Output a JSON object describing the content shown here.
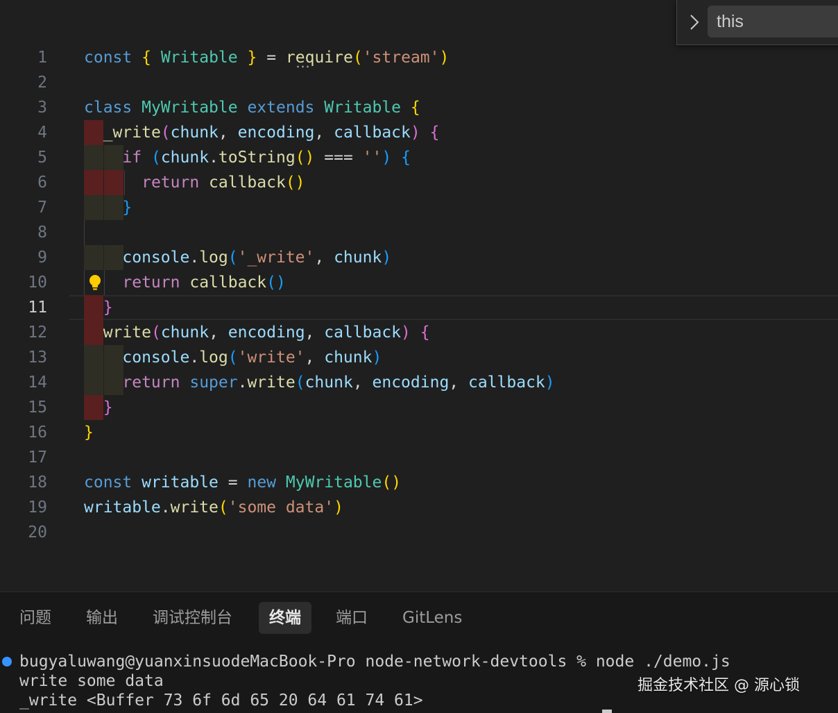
{
  "editor": {
    "line_numbers": [
      "1",
      "2",
      "3",
      "4",
      "5",
      "6",
      "7",
      "8",
      "9",
      "10",
      "11",
      "12",
      "13",
      "14",
      "15",
      "16",
      "17",
      "18",
      "19",
      "20"
    ],
    "current_line": "11",
    "lines": [
      [
        [
          "kw",
          "const"
        ],
        [
          "pl",
          " "
        ],
        [
          "b1",
          "{"
        ],
        [
          "pl",
          " "
        ],
        [
          "cls",
          "Writable"
        ],
        [
          "pl",
          " "
        ],
        [
          "b1",
          "}"
        ],
        [
          "pl",
          " "
        ],
        [
          "op",
          "="
        ],
        [
          "pl",
          " "
        ],
        [
          "fn",
          "require"
        ],
        [
          "b1",
          "("
        ],
        [
          "str",
          "'stream'"
        ],
        [
          "b1",
          ")"
        ]
      ],
      [],
      [
        [
          "kw",
          "class"
        ],
        [
          "pl",
          " "
        ],
        [
          "cls",
          "MyWritable"
        ],
        [
          "pl",
          " "
        ],
        [
          "kw",
          "extends"
        ],
        [
          "pl",
          " "
        ],
        [
          "cls",
          "Writable"
        ],
        [
          "pl",
          " "
        ],
        [
          "b1",
          "{"
        ]
      ],
      [
        [
          "pl",
          "  "
        ],
        [
          "fn",
          "_write"
        ],
        [
          "b2",
          "("
        ],
        [
          "par",
          "chunk"
        ],
        [
          "pl",
          ", "
        ],
        [
          "par",
          "encoding"
        ],
        [
          "pl",
          ", "
        ],
        [
          "par",
          "callback"
        ],
        [
          "b2",
          ")"
        ],
        [
          "pl",
          " "
        ],
        [
          "b2",
          "{"
        ]
      ],
      [
        [
          "pl",
          "    "
        ],
        [
          "ctl",
          "if"
        ],
        [
          "pl",
          " "
        ],
        [
          "b3",
          "("
        ],
        [
          "var",
          "chunk"
        ],
        [
          "pl",
          "."
        ],
        [
          "fn",
          "toString"
        ],
        [
          "b1",
          "()"
        ],
        [
          "pl",
          " "
        ],
        [
          "op",
          "==="
        ],
        [
          "pl",
          " "
        ],
        [
          "str",
          "''"
        ],
        [
          "b3",
          ")"
        ],
        [
          "pl",
          " "
        ],
        [
          "b3",
          "{"
        ]
      ],
      [
        [
          "pl",
          "      "
        ],
        [
          "ctl",
          "return"
        ],
        [
          "pl",
          " "
        ],
        [
          "fn",
          "callback"
        ],
        [
          "b1",
          "()"
        ]
      ],
      [
        [
          "pl",
          "    "
        ],
        [
          "b3",
          "}"
        ]
      ],
      [],
      [
        [
          "pl",
          "    "
        ],
        [
          "var",
          "console"
        ],
        [
          "pl",
          "."
        ],
        [
          "fn",
          "log"
        ],
        [
          "b3",
          "("
        ],
        [
          "str",
          "'_write'"
        ],
        [
          "pl",
          ", "
        ],
        [
          "var",
          "chunk"
        ],
        [
          "b3",
          ")"
        ]
      ],
      [
        [
          "pl",
          "    "
        ],
        [
          "ctl",
          "return"
        ],
        [
          "pl",
          " "
        ],
        [
          "fn",
          "callback"
        ],
        [
          "b3",
          "()"
        ]
      ],
      [
        [
          "pl",
          "  "
        ],
        [
          "b2",
          "}"
        ]
      ],
      [
        [
          "pl",
          "  "
        ],
        [
          "fn",
          "write"
        ],
        [
          "b2",
          "("
        ],
        [
          "par",
          "chunk"
        ],
        [
          "pl",
          ", "
        ],
        [
          "par",
          "encoding"
        ],
        [
          "pl",
          ", "
        ],
        [
          "par",
          "callback"
        ],
        [
          "b2",
          ")"
        ],
        [
          "pl",
          " "
        ],
        [
          "b2",
          "{"
        ]
      ],
      [
        [
          "pl",
          "    "
        ],
        [
          "var",
          "console"
        ],
        [
          "pl",
          "."
        ],
        [
          "fn",
          "log"
        ],
        [
          "b3",
          "("
        ],
        [
          "str",
          "'write'"
        ],
        [
          "pl",
          ", "
        ],
        [
          "var",
          "chunk"
        ],
        [
          "b3",
          ")"
        ]
      ],
      [
        [
          "pl",
          "    "
        ],
        [
          "ctl",
          "return"
        ],
        [
          "pl",
          " "
        ],
        [
          "kw",
          "super"
        ],
        [
          "pl",
          "."
        ],
        [
          "fn",
          "write"
        ],
        [
          "b3",
          "("
        ],
        [
          "var",
          "chunk"
        ],
        [
          "pl",
          ", "
        ],
        [
          "var",
          "encoding"
        ],
        [
          "pl",
          ", "
        ],
        [
          "var",
          "callback"
        ],
        [
          "b3",
          ")"
        ]
      ],
      [
        [
          "pl",
          "  "
        ],
        [
          "b2",
          "}"
        ]
      ],
      [
        [
          "b1",
          "}"
        ]
      ],
      [],
      [
        [
          "kw",
          "const"
        ],
        [
          "pl",
          " "
        ],
        [
          "var",
          "writable"
        ],
        [
          "pl",
          " "
        ],
        [
          "op",
          "="
        ],
        [
          "pl",
          " "
        ],
        [
          "kw",
          "new"
        ],
        [
          "pl",
          " "
        ],
        [
          "cls",
          "MyWritable"
        ],
        [
          "b1",
          "()"
        ]
      ],
      [
        [
          "var",
          "writable"
        ],
        [
          "pl",
          "."
        ],
        [
          "fn",
          "write"
        ],
        [
          "b1",
          "("
        ],
        [
          "str",
          "'some data'"
        ],
        [
          "b1",
          ")"
        ]
      ],
      []
    ]
  },
  "find": {
    "value": "this"
  },
  "panel": {
    "tabs": [
      {
        "label": "问题",
        "name": "tab-problems"
      },
      {
        "label": "输出",
        "name": "tab-output"
      },
      {
        "label": "调试控制台",
        "name": "tab-debug-console"
      },
      {
        "label": "终端",
        "name": "tab-terminal"
      },
      {
        "label": "端口",
        "name": "tab-ports"
      },
      {
        "label": "GitLens",
        "name": "tab-gitlens"
      }
    ],
    "active_tab": "终端",
    "terminal": {
      "prompt": "bugyaluwang@yuanxinsuodeMacBook-Pro node-network-devtools % node ./demo.js",
      "output": [
        "write some data",
        "_write <Buffer 73 6f 6d 65 20 64 61 74 61>"
      ]
    }
  },
  "watermark": "掘金技术社区 @ 源心锁",
  "colors": {
    "background": "#1f1f1f",
    "keyword": "#569cd6",
    "class": "#4ec9b0",
    "function": "#dcdcaa",
    "string": "#ce9178",
    "variable": "#9cdcfe",
    "control": "#c586c0",
    "bracket_1": "#ffd700",
    "bracket_2": "#da70d6",
    "bracket_3": "#179fff",
    "terminal_dot": "#3794ff"
  }
}
